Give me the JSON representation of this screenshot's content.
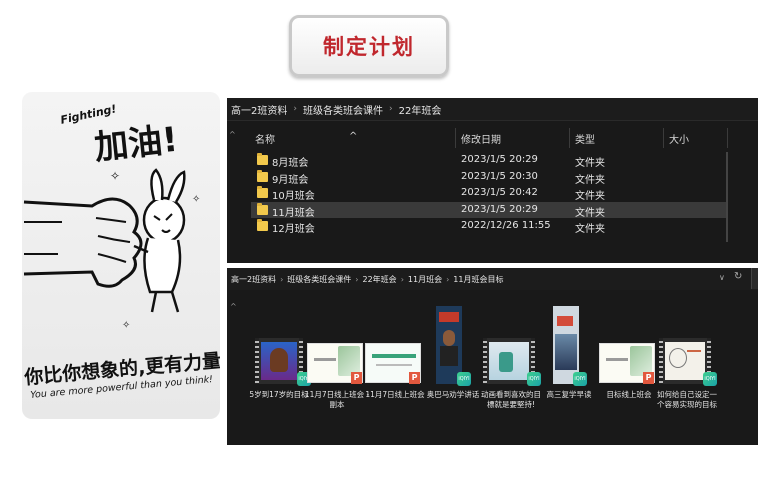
{
  "header": {
    "title": "制定计划"
  },
  "poster": {
    "fighting": "Fighting!",
    "jiayou": "加油!",
    "slogan_cn": "你比你想象的,更有力量!",
    "slogan_en": "You are more powerful than you think!"
  },
  "window1": {
    "breadcrumb": [
      "高一2班资料",
      "班级各类班会课件",
      "22年班会"
    ],
    "columns": {
      "name": "名称",
      "modified": "修改日期",
      "type": "类型",
      "size": "大小"
    },
    "rows": [
      {
        "name": "8月班会",
        "modified": "2023/1/5 20:29",
        "type": "文件夹"
      },
      {
        "name": "9月班会",
        "modified": "2023/1/5 20:30",
        "type": "文件夹"
      },
      {
        "name": "10月班会",
        "modified": "2023/1/5 20:42",
        "type": "文件夹"
      },
      {
        "name": "11月班会",
        "modified": "2023/1/5 20:29",
        "type": "文件夹",
        "selected": true
      },
      {
        "name": "12月班会",
        "modified": "2022/12/26 11:55",
        "type": "文件夹"
      }
    ]
  },
  "window2": {
    "breadcrumb": [
      "高一2班资料",
      "班级各类班会课件",
      "22年班会",
      "11月班会",
      "11月班会目标"
    ],
    "files": [
      {
        "caption": "5岁到17岁的目标",
        "kind": "video",
        "badge": "iQIYI"
      },
      {
        "caption": "11月7日线上班会 - 副本",
        "kind": "ppt",
        "badge": "P"
      },
      {
        "caption": "11月7日线上班会",
        "kind": "ppt",
        "badge": "P"
      },
      {
        "caption": "奥巴马劝学讲话",
        "kind": "video",
        "badge": "iQIYI"
      },
      {
        "caption": "动画看到喜欢的目標就是要堅持!",
        "kind": "video",
        "badge": "iQIYI"
      },
      {
        "caption": "高三复学早读",
        "kind": "video",
        "badge": "iQIYI"
      },
      {
        "caption": "目标线上班会",
        "kind": "ppt",
        "badge": "P"
      },
      {
        "caption": "如何给自己设定一个容易实现的目标",
        "kind": "video",
        "badge": "iQIYI"
      }
    ]
  },
  "colors": {
    "accent_red": "#c0272d",
    "folder": "#f2c94c",
    "explorer_bg": "#191919"
  }
}
